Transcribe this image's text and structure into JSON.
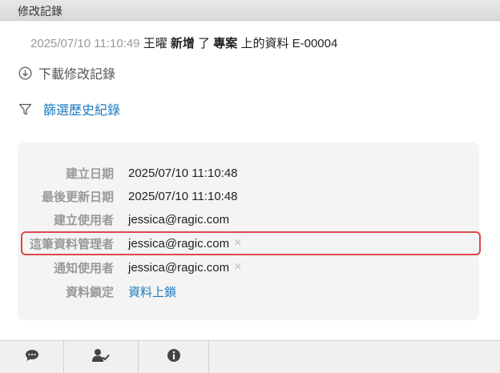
{
  "header": {
    "title": "修改記錄"
  },
  "log": {
    "timestamp": "2025/07/10 11:10:49",
    "user": "王曜",
    "action": "新增",
    "particle": "了",
    "target": "專案",
    "suffix": "上的資料 E-00004"
  },
  "actions": {
    "download_label": "下載修改記錄",
    "filter_label": "篩選歷史紀錄"
  },
  "fields": [
    {
      "label": "建立日期",
      "value": "2025/07/10 11:10:48"
    },
    {
      "label": "最後更新日期",
      "value": "2025/07/10 11:10:48"
    },
    {
      "label": "建立使用者",
      "value": "jessica@ragic.com"
    },
    {
      "label": "這筆資料管理者",
      "value": "jessica@ragic.com",
      "remove": "×"
    },
    {
      "label": "通知使用者",
      "value": "jessica@ragic.com",
      "remove": "×"
    },
    {
      "label": "資料鎖定",
      "value": "資料上鎖"
    }
  ],
  "bottom_tabs": [
    {
      "icon": "comment-icon"
    },
    {
      "icon": "user-check-icon"
    },
    {
      "icon": "info-icon"
    }
  ],
  "colors": {
    "link": "#1b7bbf",
    "highlight": "#e0474c",
    "panel": "#f4f4f4"
  }
}
